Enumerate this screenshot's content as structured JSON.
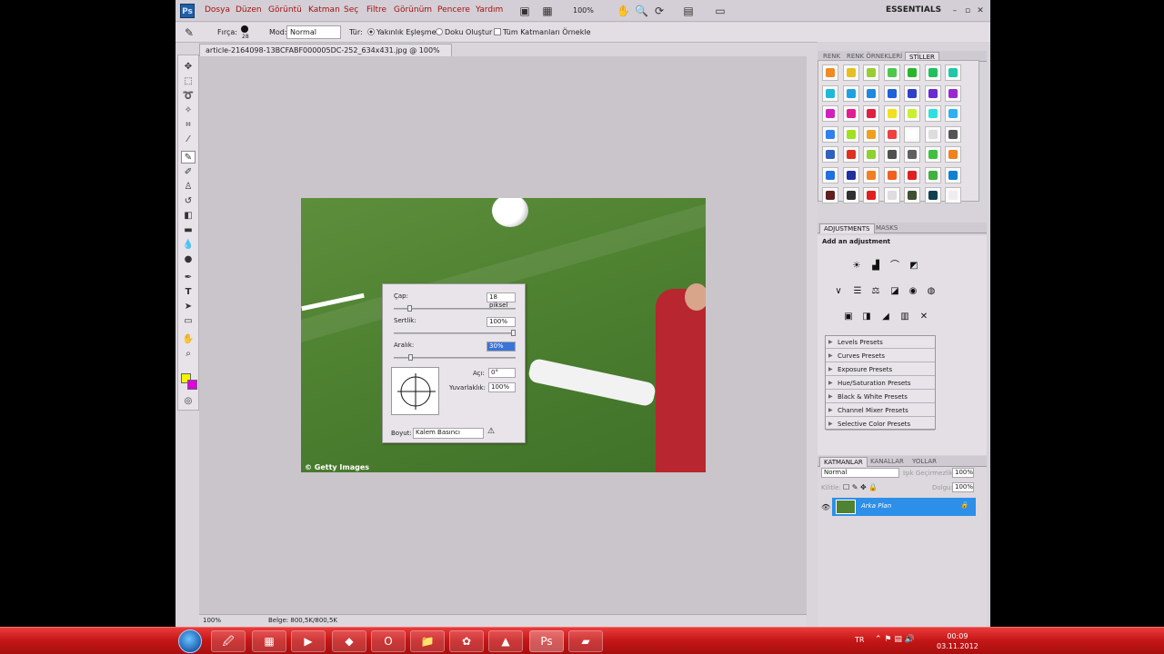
{
  "menubar": {
    "logo": "Ps",
    "items": [
      "Dosya",
      "Düzen",
      "Görüntü",
      "Katman",
      "Seç",
      "Filtre",
      "Görünüm",
      "Pencere",
      "Yardım"
    ],
    "zoom": "100%",
    "workspace": "ESSENTIALS"
  },
  "options": {
    "brush_label": "Fırça:",
    "brush_size": "28",
    "mode_label": "Mod:",
    "mode_value": "Normal",
    "type_label": "Tür:",
    "radio1": "Yakınlık Eşleşmesi",
    "radio2": "Doku Oluştur",
    "check": "Tüm Katmanları Örnekle"
  },
  "doc": {
    "tab": "article-2164098-13BCFABF000005DC-252_634x431.jpg @ 100% (RGB/8)",
    "watermark": "© Getty Images"
  },
  "brush_panel": {
    "diameter_label": "Çap:",
    "diameter_value": "18 piksel",
    "hardness_label": "Sertlik:",
    "hardness_value": "100%",
    "spacing_label": "Aralık:",
    "spacing_value": "30%",
    "angle_label": "Açı:",
    "angle_value": "0°",
    "roundness_label": "Yuvarlaklık:",
    "roundness_value": "100%",
    "size_label": "Boyut:",
    "size_value": "Kalem Basıncı"
  },
  "panels": {
    "tabs1": [
      "RENK",
      "RENK ÖRNEKLERİ",
      "STİLLER"
    ],
    "tabs2": [
      "ADJUSTMENTS",
      "MASKS"
    ],
    "add_adjustment": "Add an adjustment",
    "presets": [
      "Levels Presets",
      "Curves Presets",
      "Exposure Presets",
      "Hue/Saturation Presets",
      "Black & White Presets",
      "Channel Mixer Presets",
      "Selective Color Presets"
    ],
    "tabs3": [
      "KATMANLAR",
      "KANALLAR",
      "YOLLAR"
    ],
    "blend_mode": "Normal",
    "opacity_label": "Işık Geçirmezlik:",
    "opacity": "100%",
    "lock_label": "Kilitle:",
    "fill_label": "Dolgu:",
    "fill": "100%",
    "layer_name": "Arka Plan"
  },
  "status": {
    "zoom": "100%",
    "doc_info": "Belge: 800,5K/800,5K"
  },
  "taskbar": {
    "lang": "TR",
    "time": "00:09",
    "date": "03.11.2012"
  },
  "style_colors": [
    [
      "#f08a24",
      "#e6c020",
      "#9acd32",
      "#4cc84c",
      "#2bb52b",
      "#20c060",
      "#20c8a8"
    ],
    [
      "#20b8d8",
      "#1fa0e0",
      "#2088e0",
      "#2060d8",
      "#3040c8",
      "#6a2ad0",
      "#9a2ad0"
    ],
    [
      "#d020c0",
      "#e02090",
      "#e02040",
      "#f0e020",
      "#c8f030",
      "#30e0e0",
      "#30b0f0"
    ],
    [
      "#3080f0",
      "#a0e020",
      "#f0a020",
      "#f04040",
      "#ffffff",
      "#dddddd",
      "#555555"
    ],
    [
      "#3060c0",
      "#e03020",
      "#90d030",
      "#505050",
      "#606060",
      "#40c040",
      "#f08020"
    ],
    [
      "#2070e0",
      "#2030a0",
      "#f08020",
      "#f06020",
      "#e02020",
      "#40b040",
      "#1080d0"
    ],
    [
      "#602020",
      "#303030",
      "#e02020",
      "#dddddd",
      "#405030",
      "#104050",
      "#eeeeee"
    ]
  ]
}
